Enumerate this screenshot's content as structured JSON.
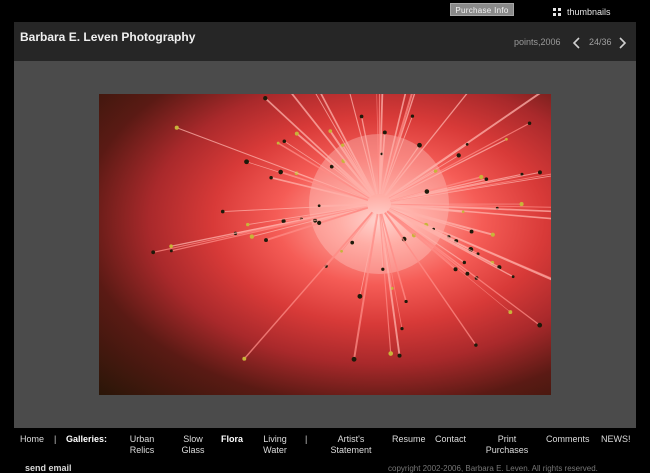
{
  "topbar": {
    "purchase_label": "Purchase Info",
    "thumbnails_label": "thumbnails"
  },
  "header": {
    "site_title": "Barbara E. Leven Photography",
    "caption": "points,2006",
    "counter": "24/36"
  },
  "photo": {
    "subject": "pink flower macro with pollen-tipped stamens"
  },
  "nav": {
    "home": "Home",
    "separator": "|",
    "galleries_label": "Galleries:",
    "urban_relics": [
      "Urban",
      "Relics"
    ],
    "slow_glass": [
      "Slow",
      "Glass"
    ],
    "flora": "Flora",
    "living_water": [
      "Living",
      "Water"
    ],
    "artists_statement": [
      "Artist's",
      "Statement"
    ],
    "resume": "Resume",
    "contact": "Contact",
    "print_purchases": [
      "Print",
      "Purchases"
    ],
    "comments": "Comments",
    "news": "NEWS!"
  },
  "footer": {
    "send_email": "send email",
    "copyright": "copyright 2002-2006, Barbara E. Leven. All rights reserved."
  },
  "colors": {
    "background": "#000000",
    "header_bg": "#262626",
    "viewer_bg": "#4b4b4b",
    "photo_accent": "#f55c56"
  }
}
